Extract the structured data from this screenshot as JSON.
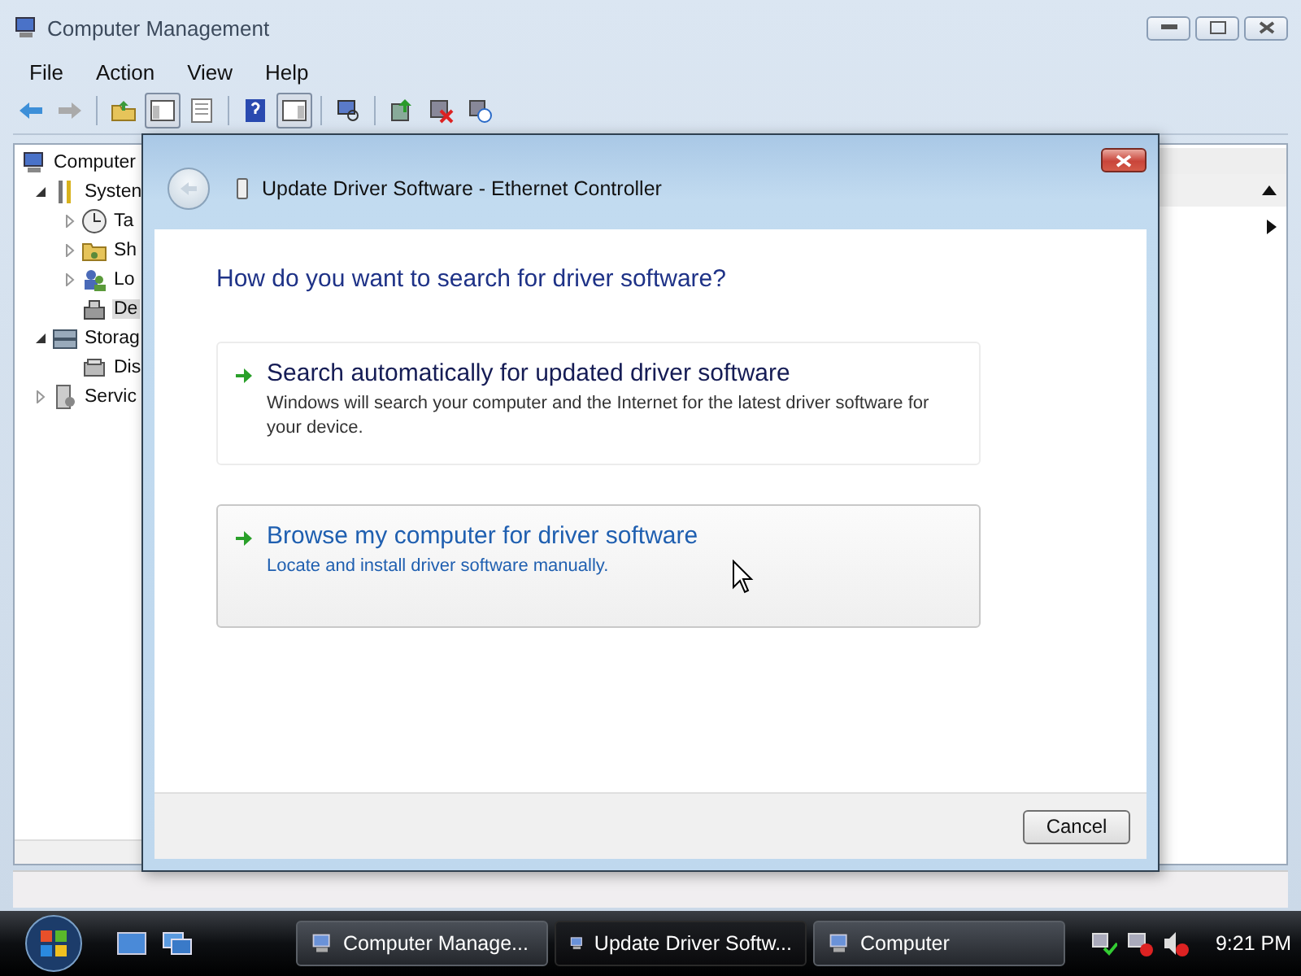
{
  "window": {
    "title": "Computer Management"
  },
  "menu": [
    "File",
    "Action",
    "View",
    "Help"
  ],
  "tree": [
    {
      "label": "Computer",
      "selected": false,
      "children": [
        {
          "label": "Systen",
          "expanded": true,
          "selected": false,
          "children": [
            {
              "label": "Ta",
              "expanded": false,
              "selected": false
            },
            {
              "label": "Sh",
              "expanded": false,
              "selected": false
            },
            {
              "label": "Lo",
              "expanded": false,
              "selected": false
            },
            {
              "label": "De",
              "selected": true
            }
          ]
        },
        {
          "label": "Storag",
          "expanded": true,
          "selected": false,
          "children": [
            {
              "label": "Dis",
              "selected": false
            }
          ]
        },
        {
          "label": "Servic",
          "expanded": false,
          "selected": false
        }
      ]
    }
  ],
  "dialog": {
    "title": "Update Driver Software - Ethernet Controller",
    "heading": "How do you want to search for driver software?",
    "options": [
      {
        "title": "Search automatically for updated driver software",
        "description": "Windows will search your computer and the Internet for the latest driver software for your device.",
        "hovered": false
      },
      {
        "title": "Browse my computer for driver software",
        "description": "Locate and install driver software manually.",
        "hovered": true
      }
    ],
    "buttons": [
      "Cancel"
    ]
  },
  "taskbar": {
    "tasks": [
      {
        "label": "Computer Manage...",
        "selected": false
      },
      {
        "label": "Update Driver Softw...",
        "selected": true
      },
      {
        "label": "Computer",
        "selected": false
      }
    ],
    "clock": "9:21 PM"
  }
}
